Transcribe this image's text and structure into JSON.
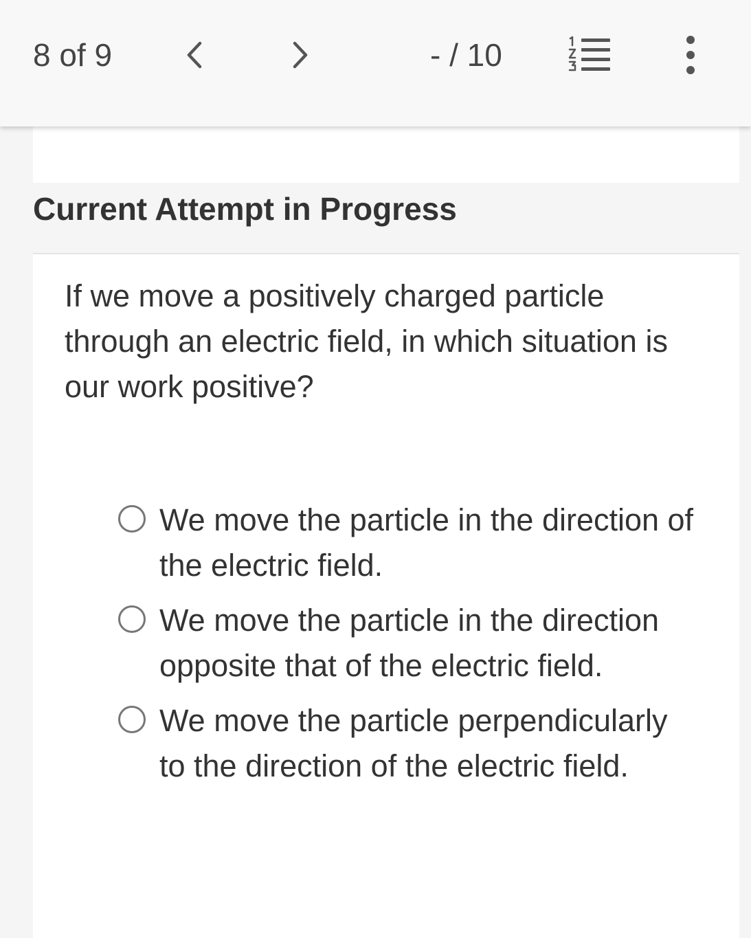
{
  "topbar": {
    "counter": "8 of 9",
    "score": "- / 10"
  },
  "attempt": {
    "title": "Current Attempt in Progress"
  },
  "question": {
    "text": "If we move a positively charged particle through an electric field, in which situation is our work positive?",
    "options": [
      "We move the particle in the direction of the electric field.",
      "We move the particle in the direction opposite that of the electric field.",
      "We move the particle perpendicularly to the direction of the electric field."
    ]
  },
  "icons": {
    "prev": "chevron-left-icon",
    "next": "chevron-right-icon",
    "list": "numbered-list-icon",
    "more": "more-vertical-icon"
  },
  "colors": {
    "topbar_bg": "#f8f8f8",
    "page_bg": "#f5f5f5",
    "panel_bg": "#ffffff",
    "text": "#333333",
    "radio_border": "#777777"
  }
}
